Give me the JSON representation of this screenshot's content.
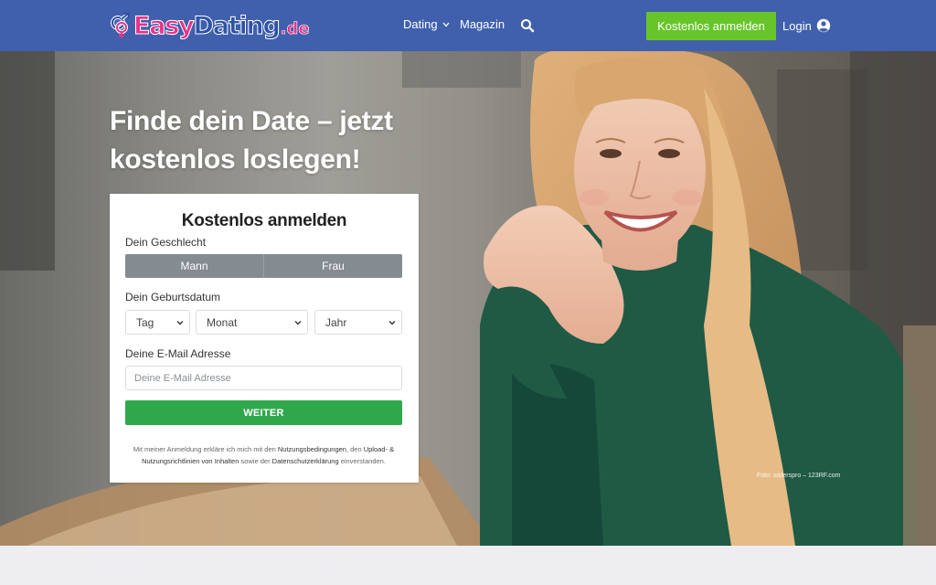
{
  "brand": {
    "logo_easy": "Easy",
    "logo_dating": "Dating",
    "logo_tld": ".de",
    "colors": {
      "nav_bg": "#4060ad",
      "pink": "#e8328a",
      "cta_green": "#67c52a",
      "submit_green": "#2fa84c"
    }
  },
  "nav": {
    "dating_label": "Dating",
    "dating_icon": "chevron-down-icon",
    "magazin_label": "Magazin",
    "search_icon": "search-icon",
    "signup_label": "Kostenlos anmelden",
    "login_label": "Login",
    "login_icon": "user-circle-icon"
  },
  "hero": {
    "title": "Finde dein Date – jetzt kostenlos loslegen!",
    "photo_credit": "Foto: sisterspro – 123RF.com"
  },
  "form": {
    "title": "Kostenlos anmelden",
    "gender_label": "Dein Geschlecht",
    "gender_options": [
      "Mann",
      "Frau"
    ],
    "birth_label": "Dein Geburtsdatum",
    "day_select": "Tag",
    "month_select": "Monat",
    "year_select": "Jahr",
    "email_label": "Deine E-Mail Adresse",
    "email_placeholder": "Deine E-Mail Adresse",
    "submit_label": "WEITER",
    "legal": {
      "part1": "Mit meiner Anmeldung erkläre ich mich mit den ",
      "link_terms": "Nutzungsbedingungen",
      "part2": ", den ",
      "link_upload": "Upload- & Nutzungsrichtlinien von Inhalten",
      "part3": " sowie der ",
      "link_privacy": "Datenschutzerklärung",
      "part4": " einverstanden."
    }
  }
}
